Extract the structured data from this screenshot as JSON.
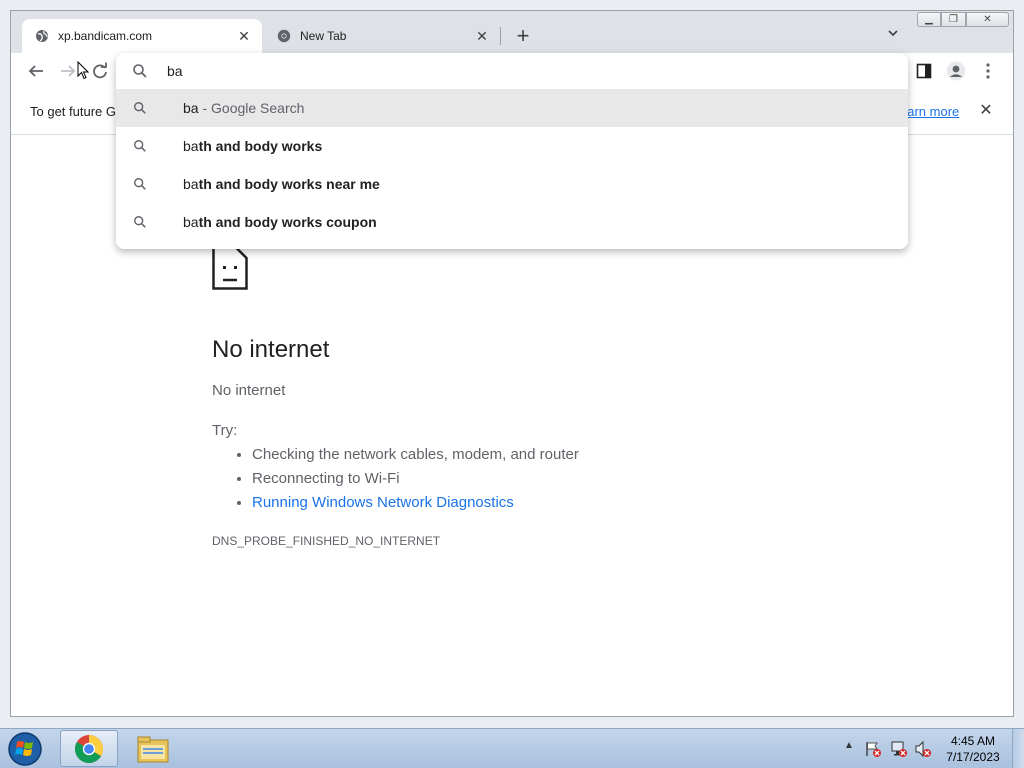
{
  "tabs": [
    {
      "title": "xp.bandicam.com",
      "icon": "globe-icon"
    },
    {
      "title": "New Tab",
      "icon": "chrome-icon"
    }
  ],
  "window_controls": {
    "minimize": "minimize-icon",
    "maximize": "maximize-icon",
    "close": "close-icon"
  },
  "omnibox": {
    "value": "ba",
    "suggestions": [
      {
        "typed": "ba",
        "rest": "",
        "suffix": " - Google Search"
      },
      {
        "typed": "ba",
        "rest": "th and body works",
        "suffix": ""
      },
      {
        "typed": "ba",
        "rest": "th and body works near me",
        "suffix": ""
      },
      {
        "typed": "ba",
        "rest": "th and body works coupon",
        "suffix": ""
      }
    ]
  },
  "infobar": {
    "text": "To get future G",
    "link": "earn more"
  },
  "error_page": {
    "title": "No internet",
    "subtitle": "No internet",
    "try_label": "Try:",
    "items": [
      "Checking the network cables, modem, and router",
      "Reconnecting to Wi-Fi"
    ],
    "link_item": "Running Windows Network Diagnostics",
    "error_code": "DNS_PROBE_FINISHED_NO_INTERNET"
  },
  "taskbar": {
    "clock_time": "4:45 AM",
    "clock_date": "7/17/2023",
    "tray_arrow": "▲"
  },
  "colors": {
    "accent": "#1a73e8",
    "tabstrip": "#dee1e6",
    "taskbar": "#b3c9e3"
  }
}
